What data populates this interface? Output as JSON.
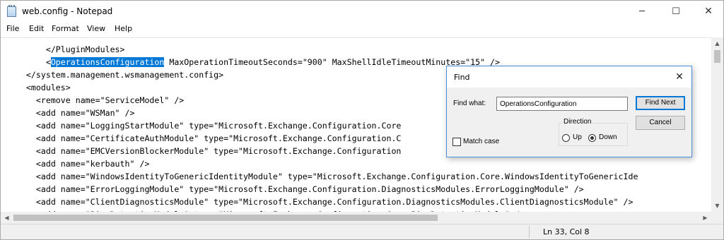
{
  "window": {
    "title": "web.config - Notepad",
    "minimize_glyph": "─",
    "maximize_glyph": "☐",
    "close_glyph": "✕"
  },
  "menu": {
    "items": [
      "File",
      "Edit",
      "Format",
      "View",
      "Help"
    ]
  },
  "editor": {
    "lines": [
      {
        "indent": "        ",
        "before": "</PluginModules>",
        "highlight": "",
        "after": ""
      },
      {
        "indent": "        ",
        "before": "<",
        "highlight": "OperationsConfiguration",
        "after": " MaxOperationTimeoutSeconds=\"900\" MaxShellIdleTimeoutMinutes=\"15\" />"
      },
      {
        "indent": "    ",
        "before": "</system.management.wsmanagement.config>",
        "highlight": "",
        "after": ""
      },
      {
        "indent": "    ",
        "before": "<modules>",
        "highlight": "",
        "after": ""
      },
      {
        "indent": "      ",
        "before": "<remove name=\"ServiceModel\" />",
        "highlight": "",
        "after": ""
      },
      {
        "indent": "      ",
        "before": "<add name=\"WSMan\" />",
        "highlight": "",
        "after": ""
      },
      {
        "indent": "      ",
        "before": "<add name=\"LoggingStartModule\" type=\"Microsoft.Exchange.Configuration.Core",
        "highlight": "",
        "after": ""
      },
      {
        "indent": "      ",
        "before": "<add name=\"CertificateAuthModule\" type=\"Microsoft.Exchange.Configuration.C                                   ati",
        "highlight": "",
        "after": ""
      },
      {
        "indent": "      ",
        "before": "<add name=\"EMCVersionBlockerModule\" type=\"Microsoft.Exchange.Configuration                                   />",
        "highlight": "",
        "after": ""
      },
      {
        "indent": "      ",
        "before": "<add name=\"kerbauth\" />",
        "highlight": "",
        "after": ""
      },
      {
        "indent": "      ",
        "before": "<add name=\"WindowsIdentityToGenericIdentityModule\" type=\"Microsoft.Exchange.Configuration.Core.WindowsIdentityToGenericIde",
        "highlight": "",
        "after": ""
      },
      {
        "indent": "      ",
        "before": "<add name=\"ErrorLoggingModule\" type=\"Microsoft.Exchange.Configuration.DiagnosticsModules.ErrorLoggingModule\" />",
        "highlight": "",
        "after": ""
      },
      {
        "indent": "      ",
        "before": "<add name=\"ClientDiagnosticsModule\" type=\"Microsoft.Exchange.Configuration.DiagnosticsModules.ClientDiagnosticsModule\" />",
        "highlight": "",
        "after": ""
      },
      {
        "indent": "      ",
        "before": "<add name=\"PingDetectionModule\" type=\"Microsoft.Exchange.Configuration.Core.PingDetectionModule\" />",
        "highlight": "",
        "after": ""
      }
    ]
  },
  "scrollbars": {
    "up_glyph": "▲",
    "down_glyph": "▼",
    "left_glyph": "◀",
    "right_glyph": "▶"
  },
  "status": {
    "position": "Ln 33, Col 8"
  },
  "find_dialog": {
    "title": "Find",
    "close_glyph": "✕",
    "find_what_label": "Find what:",
    "find_what_value": "OperationsConfiguration",
    "find_next_label": "Find Next",
    "cancel_label": "Cancel",
    "direction_label": "Direction",
    "up_label": "Up",
    "down_label": "Down",
    "direction_selected": "Down",
    "match_case_label": "Match case",
    "match_case_checked": false
  }
}
